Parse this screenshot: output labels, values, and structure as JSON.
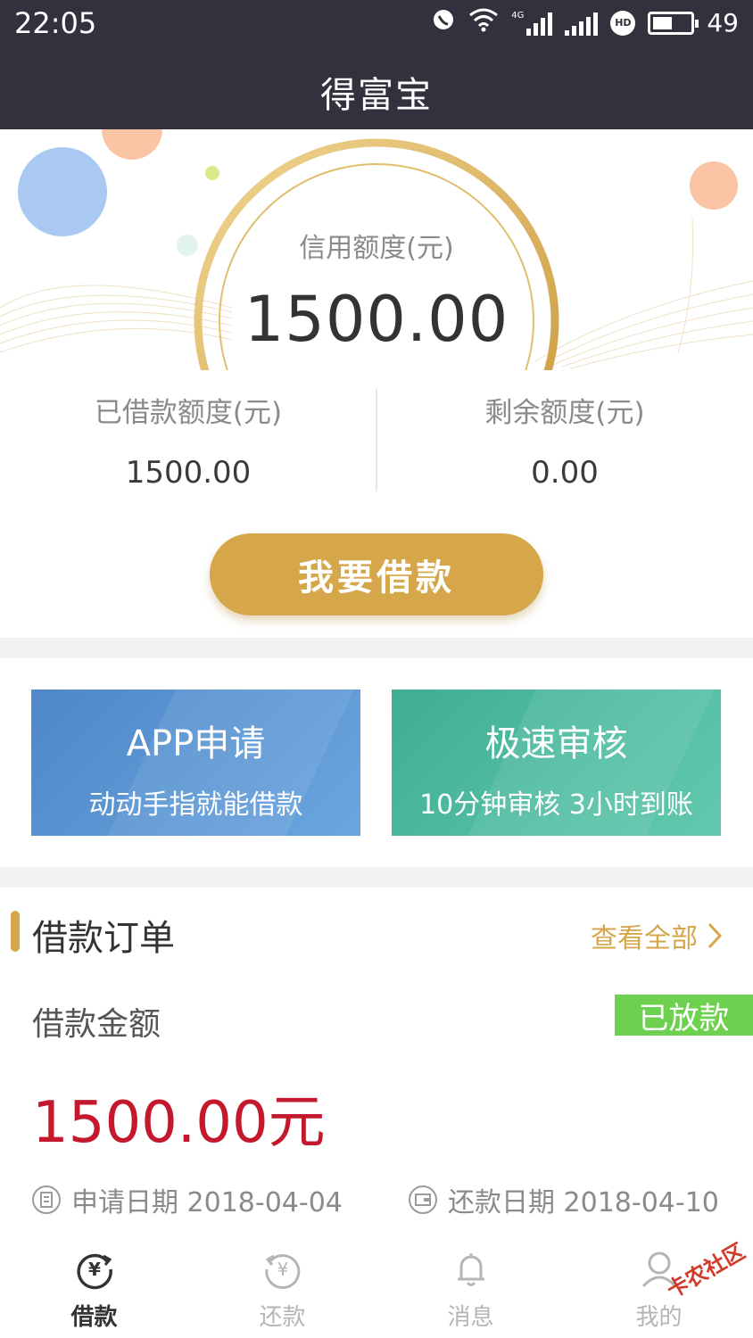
{
  "status_bar": {
    "time": "22:05",
    "network": "4G",
    "hd": "HD",
    "battery": "49"
  },
  "nav": {
    "title": "得富宝"
  },
  "credit": {
    "label": "信用额度(元)",
    "value": "1500.00"
  },
  "stats": {
    "borrowed_label": "已借款额度(元)",
    "borrowed_value": "1500.00",
    "remaining_label": "剩余额度(元)",
    "remaining_value": "0.00"
  },
  "borrow_button": "我要借款",
  "cards": [
    {
      "title": "APP申请",
      "subtitle": "动动手指就能借款",
      "color": "#5b95d3"
    },
    {
      "title": "极速审核",
      "subtitle": "10分钟审核 3小时到账",
      "color": "#4fbba0"
    }
  ],
  "orders": {
    "title": "借款订单",
    "view_all": "查看全部",
    "amount_label": "借款金额",
    "status": "已放款",
    "amount": "1500.00元",
    "apply_date_label": "申请日期 2018-04-04",
    "repay_date_label": "还款日期 2018-04-10"
  },
  "tabs": [
    {
      "label": "借款",
      "icon": "loan-yen-icon",
      "active": true
    },
    {
      "label": "还款",
      "icon": "repay-yen-icon",
      "active": false
    },
    {
      "label": "消息",
      "icon": "bell-icon",
      "active": false
    },
    {
      "label": "我的",
      "icon": "user-icon",
      "active": false
    }
  ],
  "watermark": "卡农社区",
  "colors": {
    "header": "#35303d",
    "gold": "#d5a64a",
    "amount_red": "#c4182e",
    "status_green": "#6ed04f"
  }
}
